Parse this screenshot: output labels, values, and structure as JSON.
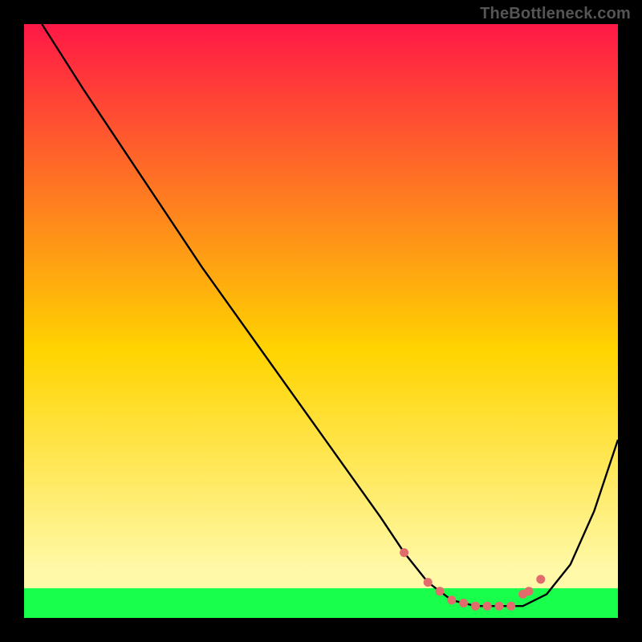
{
  "watermark": "TheBottleneck.com",
  "palette": {
    "grad_top": "#ff1846",
    "grad_mid": "#ffd400",
    "grad_bot": "#fff9a8",
    "green": "#18ff4c",
    "line": "#000000",
    "marker": "#e26c6c",
    "bg": "#000000"
  },
  "chart_data": {
    "type": "line",
    "title": "",
    "xlabel": "",
    "ylabel": "",
    "xlim": [
      0,
      100
    ],
    "ylim": [
      0,
      100
    ],
    "grid": false,
    "series": [
      {
        "name": "bottleneck-curve",
        "x": [
          3,
          10,
          20,
          30,
          40,
          50,
          60,
          64,
          68,
          72,
          76,
          80,
          84,
          88,
          92,
          96,
          100
        ],
        "y": [
          100,
          89,
          74,
          59,
          45,
          31,
          17,
          11,
          6,
          3,
          2,
          2,
          2,
          4,
          9,
          18,
          30
        ]
      }
    ],
    "markers": {
      "name": "highlight-points",
      "x": [
        64,
        68,
        70,
        72,
        74,
        76,
        78,
        80,
        82,
        84,
        85,
        87
      ],
      "y": [
        11,
        6,
        4.5,
        3,
        2.5,
        2,
        2,
        2,
        2,
        4,
        4.5,
        6.5
      ]
    },
    "green_band_y": [
      0,
      5
    ]
  }
}
